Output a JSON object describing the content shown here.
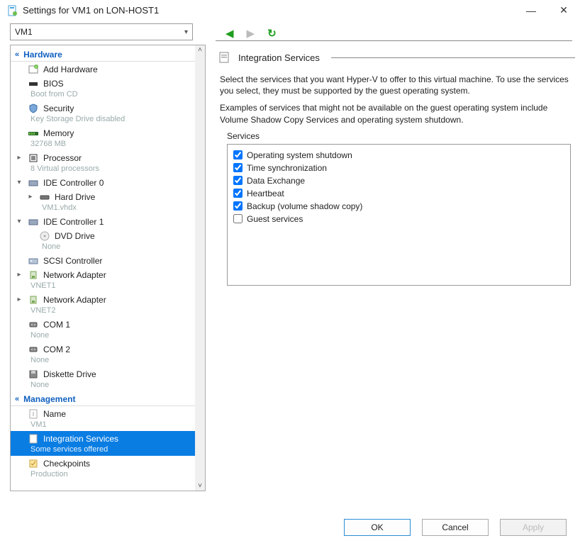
{
  "window": {
    "title": "Settings for VM1 on LON-HOST1"
  },
  "vm_selector": {
    "value": "VM1"
  },
  "sections": {
    "hardware": "Hardware",
    "management": "Management"
  },
  "hardware_items": [
    {
      "id": "add-hw",
      "label": "Add Hardware",
      "sub": "",
      "icon": "add",
      "depth": 0,
      "exp": ""
    },
    {
      "id": "bios",
      "label": "BIOS",
      "sub": "Boot from CD",
      "icon": "bios",
      "depth": 0,
      "exp": ""
    },
    {
      "id": "security",
      "label": "Security",
      "sub": "Key Storage Drive disabled",
      "icon": "shield",
      "depth": 0,
      "exp": ""
    },
    {
      "id": "memory",
      "label": "Memory",
      "sub": "32768 MB",
      "icon": "ram",
      "depth": 0,
      "exp": ""
    },
    {
      "id": "processor",
      "label": "Processor",
      "sub": "8 Virtual processors",
      "icon": "cpu",
      "depth": 0,
      "exp": "+"
    },
    {
      "id": "ide0",
      "label": "IDE Controller 0",
      "sub": "",
      "icon": "ide",
      "depth": 0,
      "exp": "-"
    },
    {
      "id": "hd",
      "label": "Hard Drive",
      "sub": "VM1.vhdx",
      "icon": "hdd",
      "depth": 1,
      "exp": "+"
    },
    {
      "id": "ide1",
      "label": "IDE Controller 1",
      "sub": "",
      "icon": "ide",
      "depth": 0,
      "exp": "-"
    },
    {
      "id": "dvd",
      "label": "DVD Drive",
      "sub": "None",
      "icon": "dvd",
      "depth": 1,
      "exp": ""
    },
    {
      "id": "scsi",
      "label": "SCSI Controller",
      "sub": "",
      "icon": "scsi",
      "depth": 0,
      "exp": ""
    },
    {
      "id": "nic1",
      "label": "Network Adapter",
      "sub": "VNET1",
      "icon": "nic",
      "depth": 0,
      "exp": "+"
    },
    {
      "id": "nic2",
      "label": "Network Adapter",
      "sub": "VNET2",
      "icon": "nic",
      "depth": 0,
      "exp": "+"
    },
    {
      "id": "com1",
      "label": "COM 1",
      "sub": "None",
      "icon": "com",
      "depth": 0,
      "exp": ""
    },
    {
      "id": "com2",
      "label": "COM 2",
      "sub": "None",
      "icon": "com",
      "depth": 0,
      "exp": ""
    },
    {
      "id": "diskette",
      "label": "Diskette Drive",
      "sub": "None",
      "icon": "floppy",
      "depth": 0,
      "exp": ""
    }
  ],
  "management_items": [
    {
      "id": "name",
      "label": "Name",
      "sub": "VM1",
      "icon": "name",
      "depth": 0,
      "exp": "",
      "selected": false
    },
    {
      "id": "integ",
      "label": "Integration Services",
      "sub": "Some services offered",
      "icon": "integ",
      "depth": 0,
      "exp": "",
      "selected": true
    },
    {
      "id": "checkpoints",
      "label": "Checkpoints",
      "sub": "Production",
      "icon": "chk",
      "depth": 0,
      "exp": "",
      "selected": false
    }
  ],
  "right": {
    "title": "Integration Services",
    "desc1": "Select the services that you want Hyper-V to offer to this virtual machine. To use the services you select, they must be supported by the guest operating system.",
    "desc2": "Examples of services that might not be available on the guest operating system include Volume Shadow Copy Services and operating system shutdown.",
    "services_label": "Services",
    "services": [
      {
        "label": "Operating system shutdown",
        "checked": true
      },
      {
        "label": "Time synchronization",
        "checked": true
      },
      {
        "label": "Data Exchange",
        "checked": true
      },
      {
        "label": "Heartbeat",
        "checked": true
      },
      {
        "label": "Backup (volume shadow copy)",
        "checked": true
      },
      {
        "label": "Guest services",
        "checked": false
      }
    ]
  },
  "footer": {
    "ok": "OK",
    "cancel": "Cancel",
    "apply": "Apply"
  }
}
